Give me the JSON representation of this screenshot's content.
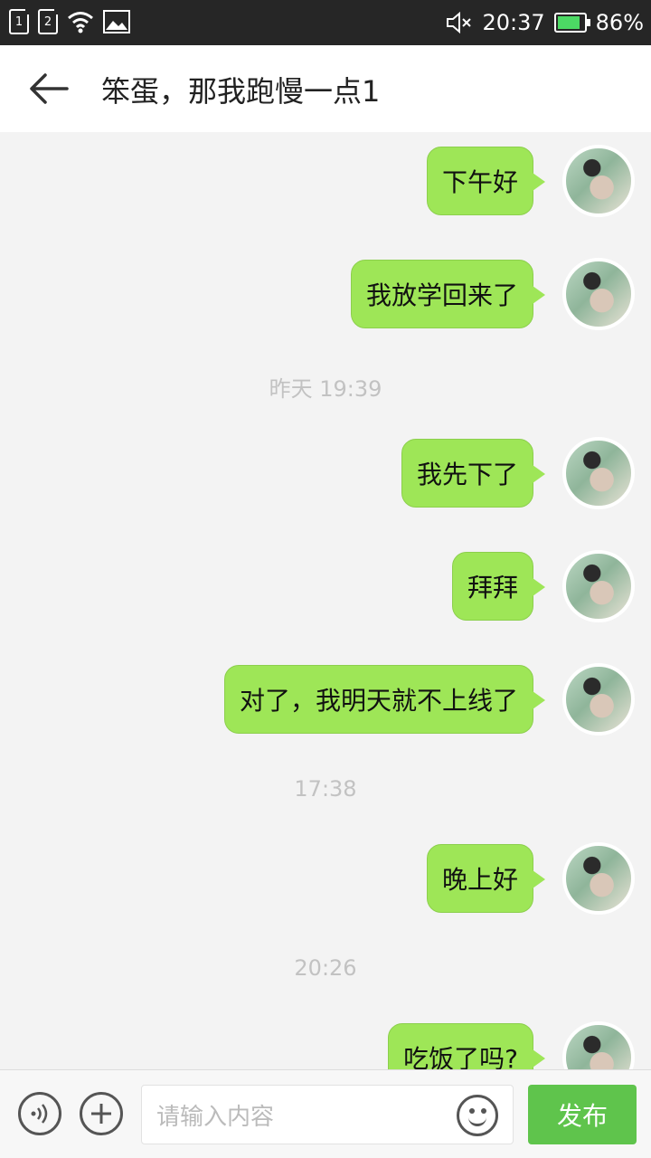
{
  "status_bar": {
    "sim1": "1",
    "sim2": "2",
    "time": "20:37",
    "battery_percent": "86%",
    "battery_level": 0.86
  },
  "header": {
    "title": "笨蛋，那我跑慢一点1"
  },
  "messages": [
    {
      "type": "sent",
      "text": "下午好"
    },
    {
      "type": "sent",
      "text": "我放学回来了"
    },
    {
      "type": "time",
      "text": "昨天 19:39"
    },
    {
      "type": "sent",
      "text": "我先下了"
    },
    {
      "type": "sent",
      "text": "拜拜"
    },
    {
      "type": "sent",
      "text": "对了，我明天就不上线了"
    },
    {
      "type": "time",
      "text": "17:38"
    },
    {
      "type": "sent",
      "text": "晚上好"
    },
    {
      "type": "time",
      "text": "20:26"
    },
    {
      "type": "sent",
      "text": "吃饭了吗?"
    }
  ],
  "input_bar": {
    "placeholder": "请输入内容",
    "send_label": "发布"
  },
  "colors": {
    "bubble": "#9ee657",
    "send_button": "#5fc44c"
  }
}
